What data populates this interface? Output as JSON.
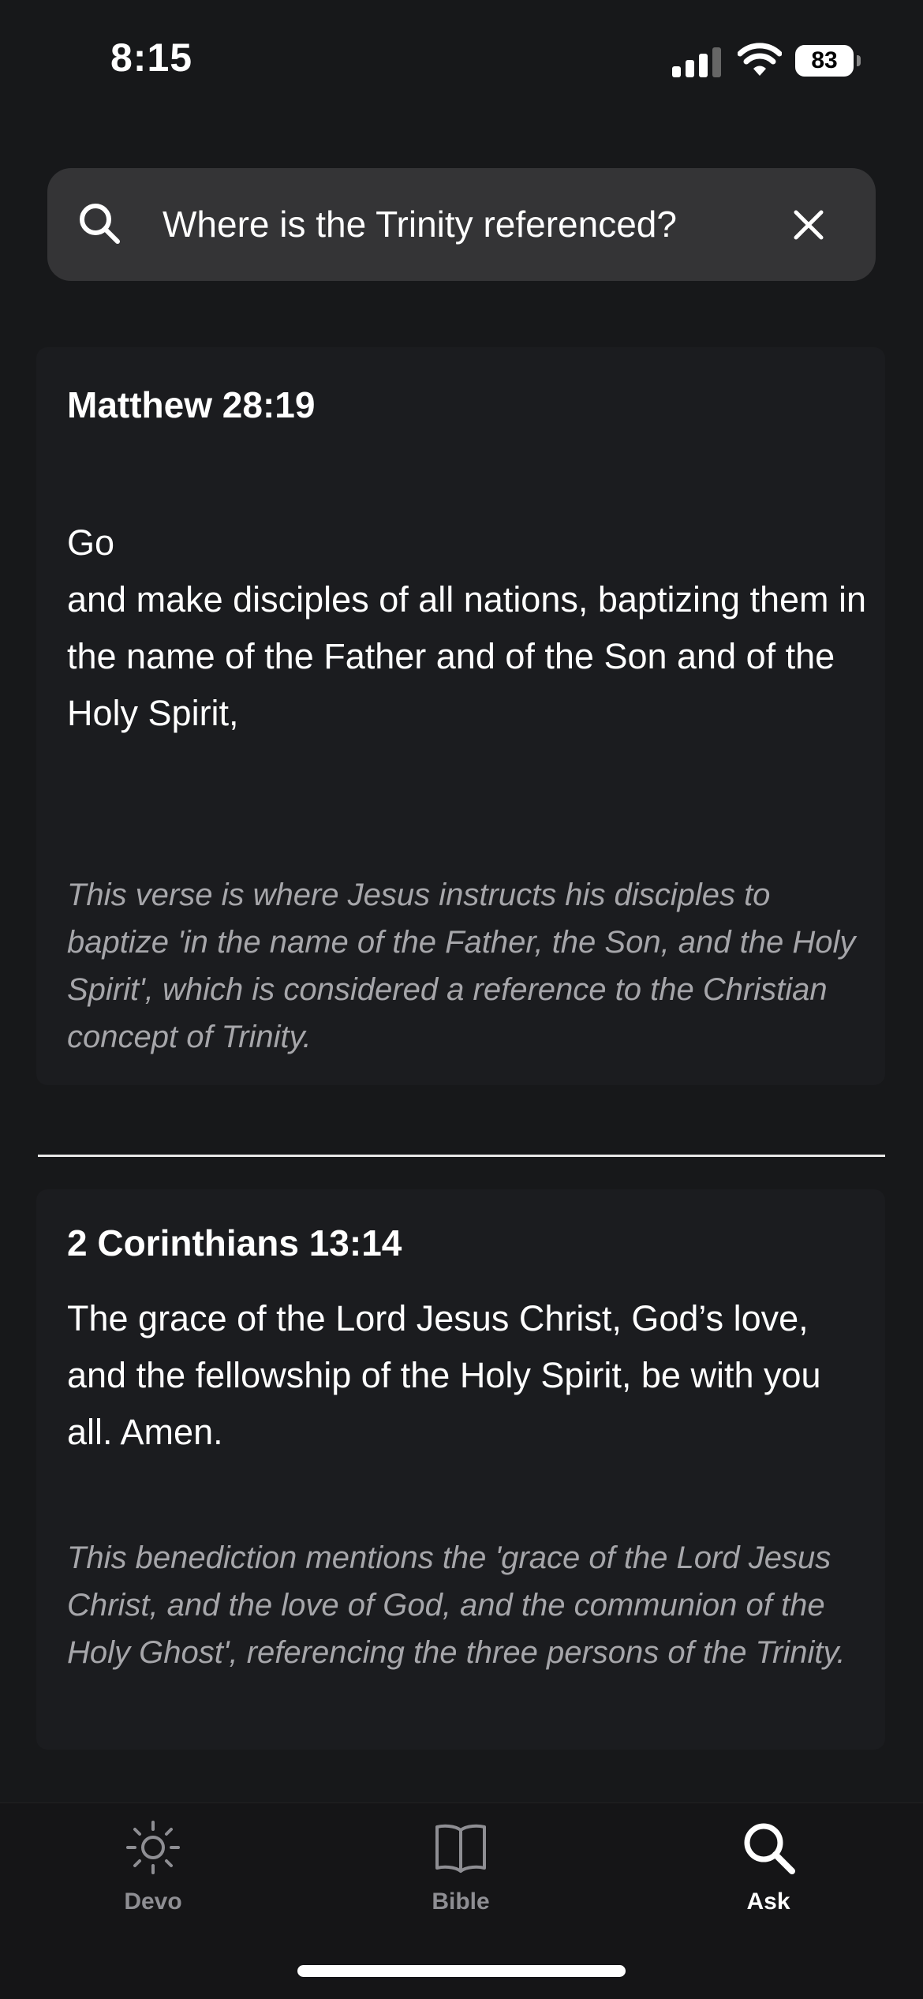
{
  "status": {
    "time": "8:15",
    "battery": "83"
  },
  "search": {
    "query": "Where is the Trinity referenced?"
  },
  "results": [
    {
      "reference": "Matthew 28:19",
      "verse": "Go\nand make disciples of all nations, baptizing them in the name of the Father and of the Son and of the Holy Spirit,",
      "explanation": "This verse is where Jesus instructs his disciples to baptize 'in the name of the Father, the Son, and the Holy Spirit', which is considered a reference to the Christian concept of Trinity."
    },
    {
      "reference": "2 Corinthians 13:14",
      "verse": "The grace of the Lord Jesus Christ, God’s love, and the fellowship of the Holy Spirit, be with you all. Amen.",
      "explanation": "This benediction mentions the 'grace of the Lord Jesus Christ, and the love of God, and the communion of the Holy Ghost', referencing the three persons of the Trinity."
    }
  ],
  "tabs": [
    {
      "label": "Devo",
      "icon": "sun-icon",
      "active": false
    },
    {
      "label": "Bible",
      "icon": "book-icon",
      "active": false
    },
    {
      "label": "Ask",
      "icon": "search-icon",
      "active": true
    }
  ],
  "colors": {
    "background": "#17181a",
    "card": "#1b1c1f",
    "search_bar": "#343436",
    "inactive_tab": "#8e8e93",
    "active_tab": "#ffffff",
    "explanation_text": "#a6a6aa"
  }
}
